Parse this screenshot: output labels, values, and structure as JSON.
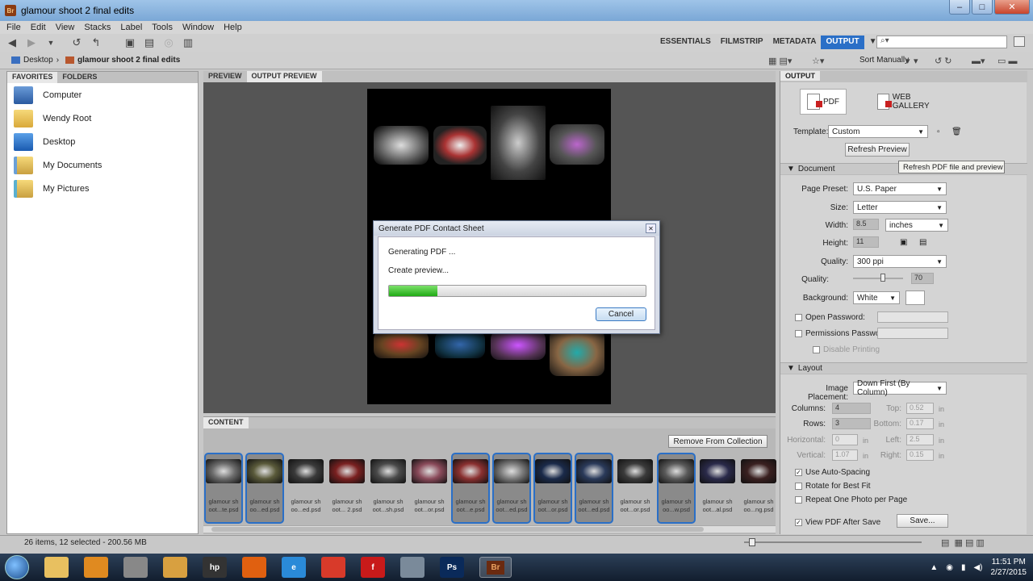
{
  "window": {
    "title": "glamour shoot 2 final edits",
    "app_badge": "Br",
    "min": "–",
    "max": "□",
    "close": "✕"
  },
  "menu": [
    "File",
    "Edit",
    "View",
    "Stacks",
    "Label",
    "Tools",
    "Window",
    "Help"
  ],
  "workspaces": [
    "ESSENTIALS",
    "FILMSTRIP",
    "METADATA",
    "OUTPUT"
  ],
  "active_workspace": "OUTPUT",
  "search": {
    "placeholder": "",
    "icon": "magnifier-icon"
  },
  "breadcrumb": [
    "Desktop",
    "glamour shoot 2 final edits"
  ],
  "sort": {
    "label": "Sort Manually"
  },
  "left_pane": {
    "tabs": [
      "FAVORITES",
      "FOLDERS"
    ],
    "items": [
      "Computer",
      "Wendy Root",
      "Desktop",
      "My Documents",
      "My Pictures"
    ]
  },
  "center_tabs": [
    "PREVIEW",
    "OUTPUT PREVIEW"
  ],
  "content": {
    "tab": "CONTENT",
    "remove_button": "Remove From Collection",
    "thumbs": [
      {
        "name": "glamour sh oot...te.psd",
        "selected": true,
        "color": "#6c6c6c"
      },
      {
        "name": "glamour sh oo...ed.psd",
        "selected": true,
        "color": "#5a5a3a"
      },
      {
        "name": "glamour sh oo...ed.psd",
        "selected": false,
        "color": "#3a3a3a"
      },
      {
        "name": "glamour sh oot... 2.psd",
        "selected": false,
        "color": "#7a2020"
      },
      {
        "name": "glamour sh oot...sh.psd",
        "selected": false,
        "color": "#4a4a4a"
      },
      {
        "name": "glamour sh oot...or.psd",
        "selected": false,
        "color": "#8a4a5a"
      },
      {
        "name": "glamour sh oot...e.psd",
        "selected": true,
        "color": "#8a3030"
      },
      {
        "name": "glamour sh oot...ed.psd",
        "selected": true,
        "color": "#7a7a7a"
      },
      {
        "name": "glamour sh oot...or.psd",
        "selected": true,
        "color": "#1a2a4a"
      },
      {
        "name": "glamour sh oot...ed.psd",
        "selected": true,
        "color": "#2a3a5a"
      },
      {
        "name": "glamour sh oot...or.psd",
        "selected": false,
        "color": "#3a3a3a"
      },
      {
        "name": "glamour sh oo...w.psd",
        "selected": true,
        "color": "#5a5a5a"
      },
      {
        "name": "glamour sh oot...al.psd",
        "selected": false,
        "color": "#2a2a4a"
      },
      {
        "name": "glamour sh oo...ng.psd",
        "selected": false,
        "color": "#3a2020"
      }
    ]
  },
  "status": {
    "text": "26 items, 12 selected - 200.56 MB"
  },
  "output": {
    "tab": "OUTPUT",
    "pdf_label": "PDF",
    "web_label": "WEB GALLERY",
    "template_label": "Template:",
    "template_value": "Custom",
    "refresh_button": "Refresh Preview",
    "tooltip": "Refresh PDF file and preview",
    "document_head": "Document",
    "page_preset_label": "Page Preset:",
    "page_preset_value": "U.S. Paper",
    "size_label": "Size:",
    "size_value": "Letter",
    "width_label": "Width:",
    "width_value": "8.5",
    "unit_value": "inches",
    "height_label": "Height:",
    "height_value": "11",
    "quality_label": "Quality:",
    "quality_value": "300 ppi",
    "quality2_label": "Quality:",
    "quality2_value": "70",
    "background_label": "Background:",
    "background_value": "White",
    "open_password": "Open Password:",
    "perm_password": "Permissions Password:",
    "disable_printing": "Disable Printing",
    "layout_head": "Layout",
    "placement_label": "Image Placement:",
    "placement_value": "Down First (By Column)",
    "columns_label": "Columns:",
    "columns_value": "4",
    "rows_label": "Rows:",
    "rows_value": "3",
    "top_label": "Top:",
    "top_value": "0.52",
    "bottom_label": "Bottom:",
    "bottom_value": "0.17",
    "horizontal_label": "Horizontal:",
    "horizontal_value": "0",
    "left_label": "Left:",
    "left_value": "2.5",
    "vertical_label": "Vertical:",
    "vertical_value": "1.07",
    "right_label": "Right:",
    "right_value": "0.15",
    "in": "in",
    "auto_spacing": "Use Auto-Spacing",
    "rotate": "Rotate for Best Fit",
    "repeat": "Repeat One Photo per Page",
    "view_pdf": "View PDF After Save",
    "save_button": "Save..."
  },
  "dialog": {
    "title": "Generate PDF Contact Sheet",
    "line1": "Generating PDF ...",
    "line2": "Create preview...",
    "progress": 0.19,
    "cancel": "Cancel"
  },
  "taskbar": {
    "time": "11:51 PM",
    "date": "2/27/2015",
    "apps": [
      {
        "name": "explorer-icon",
        "label": "",
        "color": "#e8c060"
      },
      {
        "name": "media-player-icon",
        "label": "",
        "color": "#e08a20"
      },
      {
        "name": "security-icon",
        "label": "",
        "color": "#888888"
      },
      {
        "name": "folder-app-icon",
        "label": "",
        "color": "#d8a040"
      },
      {
        "name": "hp-icon",
        "label": "hp",
        "color": "#333333"
      },
      {
        "name": "firefox-icon",
        "label": "",
        "color": "#e06010"
      },
      {
        "name": "ie-icon",
        "label": "e",
        "color": "#2a8ad8"
      },
      {
        "name": "chrome-icon",
        "label": "",
        "color": "#d83a2a"
      },
      {
        "name": "flash-icon",
        "label": "f",
        "color": "#c81a1a"
      },
      {
        "name": "network-icon",
        "label": "",
        "color": "#7a8a9a"
      },
      {
        "name": "photoshop-icon",
        "label": "Ps",
        "color": "#0a2a5a"
      },
      {
        "name": "bridge-icon",
        "label": "Br",
        "color": "#6a2a10"
      }
    ]
  }
}
